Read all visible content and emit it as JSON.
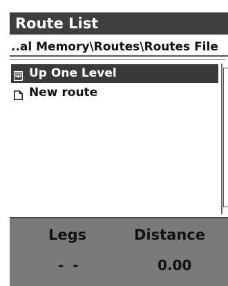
{
  "window": {
    "title": "Route List"
  },
  "path": {
    "text": "..al Memory\\Routes\\Routes File"
  },
  "list": {
    "items": [
      {
        "label": "Up One Level",
        "icon": "folder-up-icon",
        "selected": true
      },
      {
        "label": "New route",
        "icon": "document-icon",
        "selected": false
      }
    ]
  },
  "footer": {
    "legs_label": "Legs",
    "distance_label": "Distance",
    "legs_value": "- -",
    "distance_value": "0.00"
  },
  "colors": {
    "titlebar": "#3e3e3e",
    "selection": "#3a3a3a",
    "footer": "#7a7a7a"
  }
}
